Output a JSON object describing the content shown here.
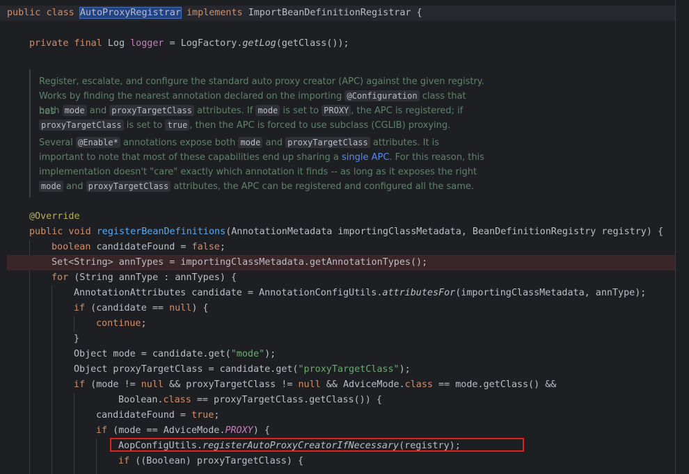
{
  "class_decl": {
    "kw_public": "public",
    "kw_class": "class",
    "class_name": "AutoProxyRegistrar",
    "kw_implements": "implements",
    "interface": "ImportBeanDefinitionRegistrar",
    "brace": "{"
  },
  "logger_line": {
    "kw_private": "private",
    "kw_final": "final",
    "type": "Log",
    "field": "logger",
    "assign": "=",
    "factory": "LogFactory.",
    "method": "getLog",
    "args": "(getClass());"
  },
  "javadoc": {
    "p1_t1": "Register, escalate, and configure the standard auto proxy creator (APC) against the given registry.",
    "p1_t2": "Works by finding the nearest annotation declared on the importing",
    "p1_c1": "@Configuration",
    "p1_t3": "class that has",
    "p1_t4": "both",
    "p1_c2": "mode",
    "p1_t5": "and",
    "p1_c3": "proxyTargetClass",
    "p1_t6": "attributes. If",
    "p1_c4": "mode",
    "p1_t7": "is set to",
    "p1_c5": "PROXY",
    "p1_t8": ", the APC is registered; if",
    "p1_c6": "proxyTargetClass",
    "p1_t9": "is set to",
    "p1_c7": "true",
    "p1_t10": ", then the APC is forced to use subclass (CGLIB) proxying.",
    "p2_t1": "Several",
    "p2_c1": "@Enable*",
    "p2_t2": "annotations expose both",
    "p2_c2": "mode",
    "p2_t3": "and",
    "p2_c3": "proxyTargetClass",
    "p2_t4": "attributes. It is",
    "p2_t5": "important to note that most of these capabilities end up sharing a",
    "p2_link": "single APC",
    "p2_t6": ". For this reason, this",
    "p2_t7": "implementation doesn't \"care\" exactly which annotation it finds -- as long as it exposes the right",
    "p2_c4": "mode",
    "p2_t8": "and",
    "p2_c5": "proxyTargetClass",
    "p2_t9": "attributes, the APC can be registered and configured all the same."
  },
  "code": {
    "override": "@Override",
    "method_sig_kw": "public void",
    "method_name": "registerBeanDefinitions",
    "method_params": "(AnnotationMetadata importingClassMetadata, BeanDefinitionRegistry registry) {",
    "l_bool_kw": "boolean",
    "l_bool_rest": " candidateFound = ",
    "l_bool_false": "false",
    "l_set": "Set<String> annTypes = importingClassMetadata.getAnnotationTypes();",
    "l_for_kw": "for",
    "l_for_rest": " (String annType : annTypes) {",
    "l_attr_a": "AnnotationAttributes candidate = AnnotationConfigUtils.",
    "l_attr_m": "attributesFor",
    "l_attr_b": "(importingClassMetadata, annType);",
    "l_if1_kw": "if",
    "l_if1_a": " (candidate == ",
    "l_if1_null": "null",
    "l_if1_b": ") {",
    "l_continue": "continue",
    "l_semi": ";",
    "l_close": "}",
    "l_mode_a": "Object mode = candidate.get(",
    "l_mode_s": "\"mode\"",
    "l_mode_b": ");",
    "l_ptc_a": "Object proxyTargetClass = candidate.get(",
    "l_ptc_s": "\"proxyTargetClass\"",
    "l_ptc_b": ");",
    "l_if2_kw": "if",
    "l_if2_a": " (mode != ",
    "l_if2_null1": "null",
    "l_if2_b": " && proxyTargetClass != ",
    "l_if2_null2": "null",
    "l_if2_c": " && AdviceMode.",
    "l_if2_class": "class",
    "l_if2_d": " == mode.getClass() &&",
    "l_bool2_a": "Boolean.",
    "l_bool2_class": "class",
    "l_bool2_b": " == proxyTargetClass.getClass()) {",
    "l_cf_a": "candidateFound = ",
    "l_cf_true": "true",
    "l_cf_b": ";",
    "l_if3_kw": "if",
    "l_if3_a": " (mode == AdviceMode.",
    "l_if3_proxy": "PROXY",
    "l_if3_b": ") {",
    "l_aop_a": "AopConfigUtils.",
    "l_aop_m": "registerAutoProxyCreatorIfNecessary",
    "l_aop_b": "(registry);",
    "l_if4_kw": "if",
    "l_if4_rest": " ((Boolean) proxyTargetClass) {"
  }
}
